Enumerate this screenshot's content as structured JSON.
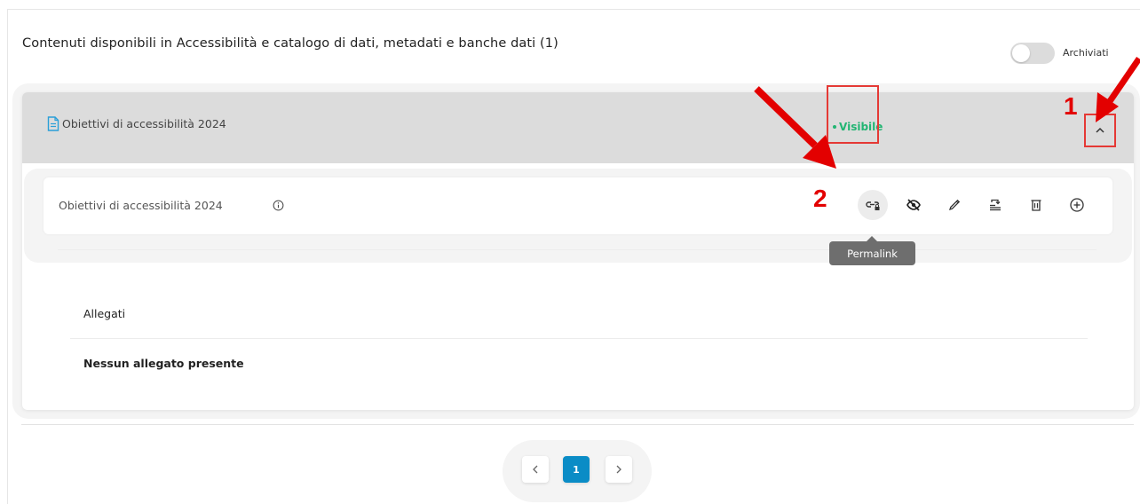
{
  "section": {
    "title": "Contenuti disponibili in Accessibilità e catalogo di dati, metadati e banche dati (1)",
    "archive_toggle_label": "Archiviati",
    "archive_toggle_on": false
  },
  "accordion": {
    "header_title": "Obiettivi di accessibilità 2024",
    "status": "Visibile",
    "status_color": "#22b573",
    "header_icon": "document-icon",
    "toggle_icon": "chevron-up-icon"
  },
  "item": {
    "title": "Obiettivi di accessibilità 2024",
    "info_icon": "info-icon",
    "actions": [
      {
        "name": "permalink",
        "icon": "link-lock-icon"
      },
      {
        "name": "visibility",
        "icon": "eye-off-icon"
      },
      {
        "name": "edit",
        "icon": "pencil-icon"
      },
      {
        "name": "move",
        "icon": "move-icon"
      },
      {
        "name": "delete",
        "icon": "trash-icon"
      },
      {
        "name": "add",
        "icon": "plus-circle-icon"
      }
    ],
    "tooltip": "Permalink"
  },
  "attachments": {
    "label": "Allegati",
    "empty_text": "Nessun allegato presente"
  },
  "pagination": {
    "current_page": "1",
    "prev_icon": "chevron-left-icon",
    "next_icon": "chevron-right-icon",
    "active_color": "#0a8cc6"
  },
  "annotations": {
    "marker_1": "1",
    "marker_2": "2",
    "color": "#e30000"
  }
}
